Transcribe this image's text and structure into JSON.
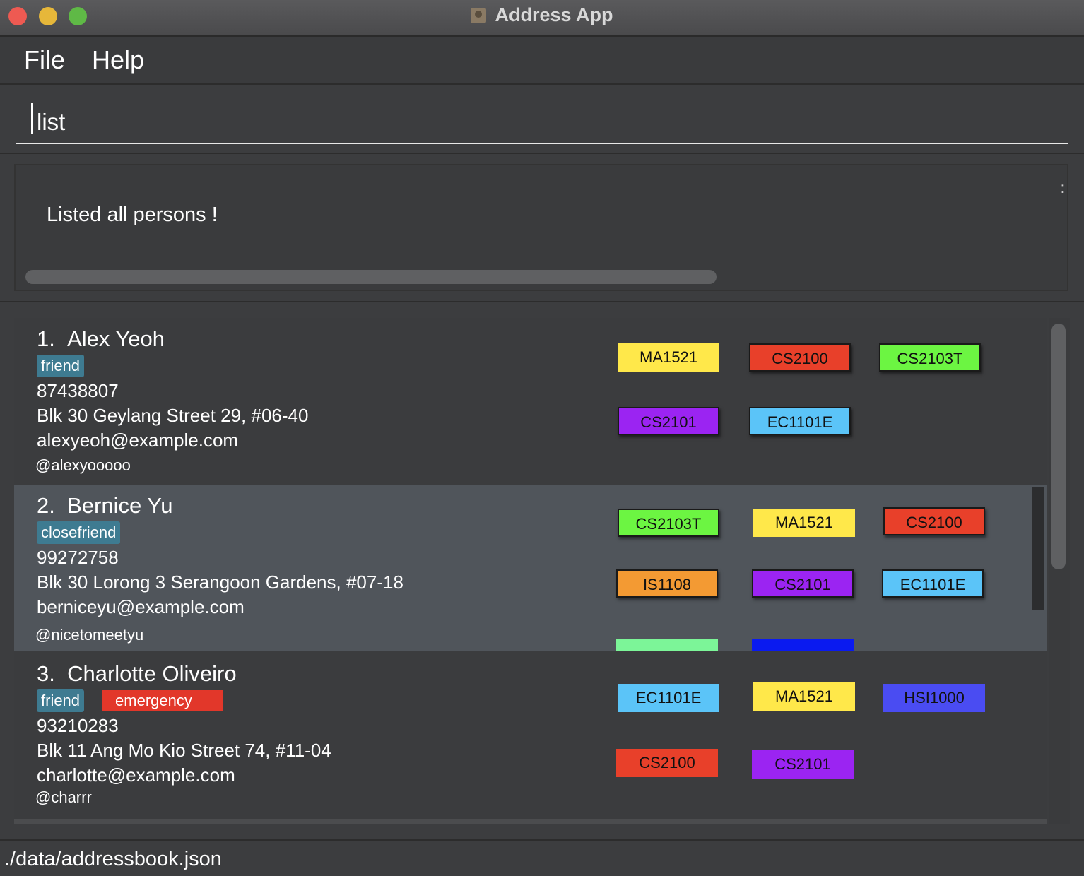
{
  "window": {
    "title": "Address App"
  },
  "menu": {
    "file": "File",
    "help": "Help"
  },
  "command": {
    "value": "list"
  },
  "result": {
    "message": "Listed all persons !"
  },
  "persons": [
    {
      "index": "1.",
      "name": "Alex Yeoh",
      "tags": [
        {
          "label": "friend",
          "color": "#3e7b91"
        }
      ],
      "phone": "87438807",
      "address": "Blk 30 Geylang Street 29, #06-40",
      "email": "alexyeoh@example.com",
      "handle": "@alexyooooo",
      "modules": [
        {
          "code": "MA1521",
          "color": "#ffe84a"
        },
        {
          "code": "CS2100",
          "color": "#e8402a"
        },
        {
          "code": "CS2103T",
          "color": "#6cf542"
        },
        {
          "code": "CS2101",
          "color": "#9b24f2"
        },
        {
          "code": "EC1101E",
          "color": "#5bc4f8"
        }
      ]
    },
    {
      "index": "2.",
      "name": "Bernice Yu",
      "tags": [
        {
          "label": "closefriend",
          "color": "#3e7b91"
        }
      ],
      "phone": "99272758",
      "address": "Blk 30 Lorong 3 Serangoon Gardens, #07-18",
      "email": "berniceyu@example.com",
      "handle": "@nicetomeetyu",
      "modules": [
        {
          "code": "CS2103T",
          "color": "#6cf542"
        },
        {
          "code": "MA1521",
          "color": "#ffe84a"
        },
        {
          "code": "CS2100",
          "color": "#e8402a"
        },
        {
          "code": "IS1108",
          "color": "#f39a33"
        },
        {
          "code": "CS2101",
          "color": "#9b24f2"
        },
        {
          "code": "EC1101E",
          "color": "#5bc4f8"
        }
      ],
      "partial_colors": [
        "#7cf598",
        "#0a1af0"
      ]
    },
    {
      "index": "3.",
      "name": "Charlotte Oliveiro",
      "tags": [
        {
          "label": "friend",
          "color": "#3e7b91"
        },
        {
          "label": "emergency",
          "color": "#e2372a"
        }
      ],
      "phone": "93210283",
      "address": "Blk 11 Ang Mo Kio Street 74, #11-04",
      "email": "charlotte@example.com",
      "handle": "@charrr",
      "modules": [
        {
          "code": "EC1101E",
          "color": "#5bc4f8"
        },
        {
          "code": "MA1521",
          "color": "#ffe84a"
        },
        {
          "code": "HSI1000",
          "color": "#4a4cf2"
        },
        {
          "code": "CS2100",
          "color": "#e8402a"
        },
        {
          "code": "CS2101",
          "color": "#9b24f2"
        }
      ]
    }
  ],
  "status": {
    "path": "./data/addressbook.json"
  }
}
